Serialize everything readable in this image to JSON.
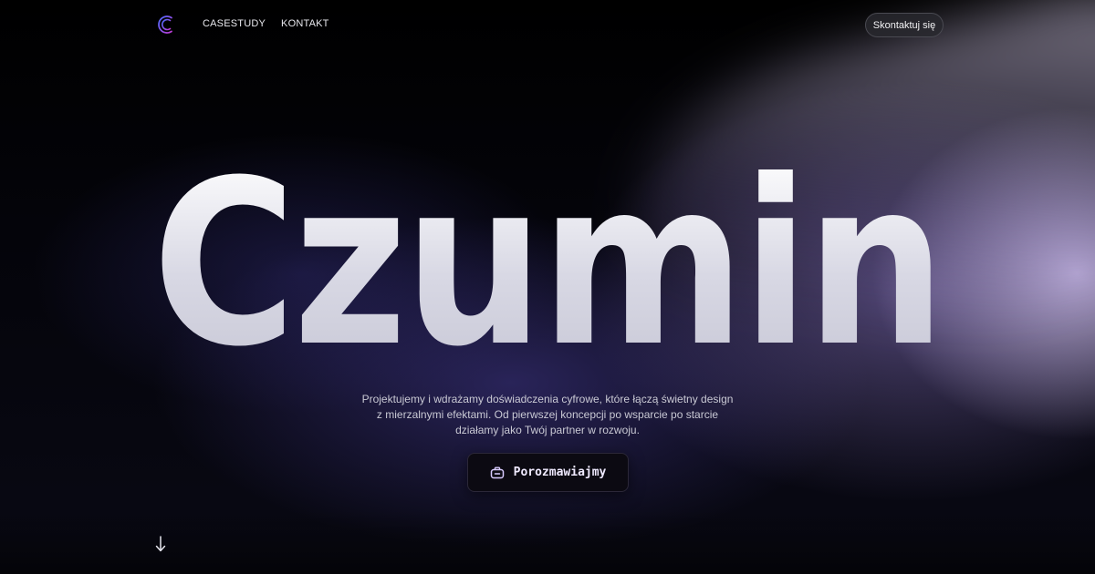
{
  "header": {
    "logo_icon": "crescent-c-logo-icon",
    "nav": [
      {
        "label": "CASESTUDY"
      },
      {
        "label": "KONTAKT"
      }
    ],
    "contact_button": "Skontaktuj się"
  },
  "hero": {
    "title": "Czumin",
    "description_lines": [
      "Projektujemy i wdrażamy doświadczenia cyfrowe, które łączą świetny design",
      "z mierzalnymi efektami. Od pierwszej koncepcji po wsparcie po starcie",
      "działamy jako Twój partner w rozwoju."
    ],
    "cta": {
      "label": "Porozmawiajmy",
      "icon": "chat-bubble-icon"
    }
  },
  "scroll_indicator_icon": "arrow-down-icon",
  "colors": {
    "background": "#05050a",
    "accent_purple": "#8b7fd6",
    "logo_gradient_start": "#4b6cff",
    "logo_gradient_end": "#c03bd6"
  }
}
